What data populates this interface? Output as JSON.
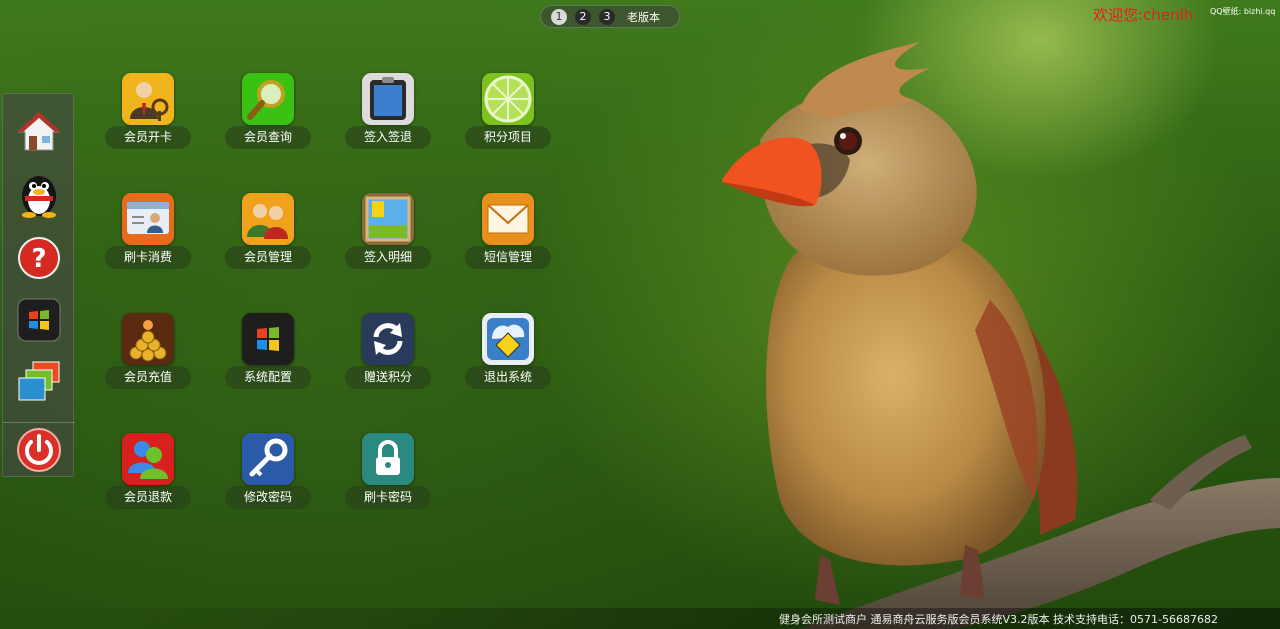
{
  "pager": {
    "pages": [
      "1",
      "2",
      "3"
    ],
    "active_page": "1",
    "old_version_label": "老版本"
  },
  "header": {
    "welcome": "欢迎您:chenlh",
    "wallpaper_tag": "QQ壁纸: bizhi.qq"
  },
  "dock": {
    "items": [
      {
        "name": "home",
        "icon": "house-icon"
      },
      {
        "name": "qq",
        "icon": "penguin-icon"
      },
      {
        "name": "help",
        "icon": "question-icon"
      },
      {
        "name": "windows",
        "icon": "windows-logo-icon"
      },
      {
        "name": "windows-switch",
        "icon": "stacked-windows-icon"
      },
      {
        "name": "power",
        "icon": "power-icon"
      }
    ]
  },
  "apps": [
    {
      "label": "会员开卡",
      "icon": "member-card-icon"
    },
    {
      "label": "会员查询",
      "icon": "magnifier-icon"
    },
    {
      "label": "签入签退",
      "icon": "clipboard-icon"
    },
    {
      "label": "积分项目",
      "icon": "lime-slice-icon"
    },
    {
      "label": "刷卡消费",
      "icon": "id-card-icon"
    },
    {
      "label": "会员管理",
      "icon": "people-icon"
    },
    {
      "label": "签入明细",
      "icon": "picture-icon"
    },
    {
      "label": "短信管理",
      "icon": "envelope-icon"
    },
    {
      "label": "会员充值",
      "icon": "gold-coins-icon"
    },
    {
      "label": "系统配置",
      "icon": "windows-logo-icon"
    },
    {
      "label": "赠送积分",
      "icon": "refresh-arrows-icon"
    },
    {
      "label": "退出系统",
      "icon": "exit-sign-icon"
    },
    {
      "label": "会员退款",
      "icon": "msn-people-icon"
    },
    {
      "label": "修改密码",
      "icon": "key-icon"
    },
    {
      "label": "刷卡密码",
      "icon": "padlock-icon"
    }
  ],
  "footer": {
    "text": "健身会所测试商户 通易商舟云服务版会员系统V3.2版本 技术支持电话：0571-56687682"
  },
  "colors": {
    "welcome": "#e2211c",
    "background_green": "#2d5a14",
    "bird_body": "#b98a45",
    "bird_beak": "#f0531f"
  }
}
